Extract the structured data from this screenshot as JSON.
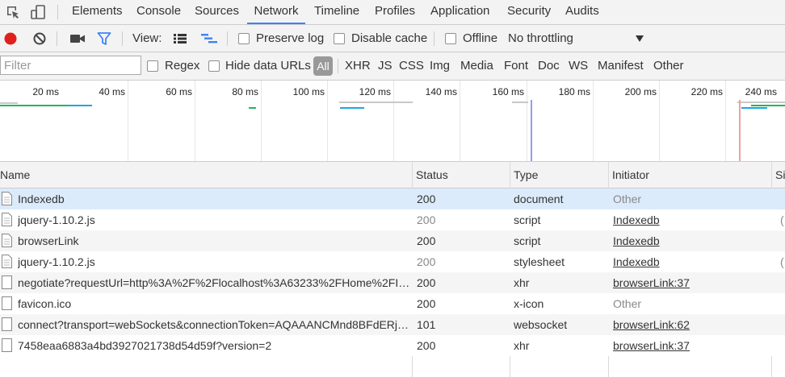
{
  "tabs": [
    {
      "label": "Elements",
      "selected": false
    },
    {
      "label": "Console",
      "selected": false
    },
    {
      "label": "Sources",
      "selected": false
    },
    {
      "label": "Network",
      "selected": true
    },
    {
      "label": "Timeline",
      "selected": false
    },
    {
      "label": "Profiles",
      "selected": false
    },
    {
      "label": "Application",
      "selected": false
    },
    {
      "label": "Security",
      "selected": false
    },
    {
      "label": "Audits",
      "selected": false
    }
  ],
  "toolbar": {
    "view_label": "View:",
    "preserve_log": "Preserve log",
    "disable_cache": "Disable cache",
    "offline": "Offline",
    "throttling": "No throttling",
    "record_color": "#e0201c",
    "filter_color": "#3e82f7"
  },
  "filterbar": {
    "placeholder": "Filter",
    "regex": "Regex",
    "hide_data_urls": "Hide data URLs",
    "all": "All",
    "types": [
      "XHR",
      "JS",
      "CSS",
      "Img",
      "Media",
      "Font",
      "Doc",
      "WS",
      "Manifest",
      "Other"
    ]
  },
  "overview": {
    "ticks": [
      "20 ms",
      "40 ms",
      "60 ms",
      "80 ms",
      "100 ms",
      "120 ms",
      "140 ms",
      "160 ms",
      "180 ms",
      "200 ms",
      "220 ms",
      "240 ms"
    ]
  },
  "table": {
    "columns": {
      "name": "Name",
      "status": "Status",
      "type": "Type",
      "initiator": "Initiator",
      "size": "Si"
    },
    "rows": [
      {
        "name": "Indexedb",
        "status": "200",
        "type": "document",
        "initiator": "Other",
        "size": ""
      },
      {
        "name": "jquery-1.10.2.js",
        "status": "200",
        "type": "script",
        "initiator": "Indexedb",
        "size": "("
      },
      {
        "name": "browserLink",
        "status": "200",
        "type": "script",
        "initiator": "Indexedb",
        "size": ""
      },
      {
        "name": "jquery-1.10.2.js",
        "status": "200",
        "type": "stylesheet",
        "initiator": "Indexedb",
        "size": "("
      },
      {
        "name": "negotiate?requestUrl=http%3A%2F%2Flocalhost%3A63233%2FHome%2FInde...",
        "status": "200",
        "type": "xhr",
        "initiator": "browserLink:37",
        "size": ""
      },
      {
        "name": "favicon.ico",
        "status": "200",
        "type": "x-icon",
        "initiator": "Other",
        "size": ""
      },
      {
        "name": "connect?transport=webSockets&connectionToken=AQAAANCMnd8BFdERjHo...",
        "status": "101",
        "type": "websocket",
        "initiator": "browserLink:62",
        "size": ""
      },
      {
        "name": "7458eaa6883a4bd3927021738d54d59f?version=2",
        "status": "200",
        "type": "xhr",
        "initiator": "browserLink:37",
        "size": ""
      }
    ]
  }
}
